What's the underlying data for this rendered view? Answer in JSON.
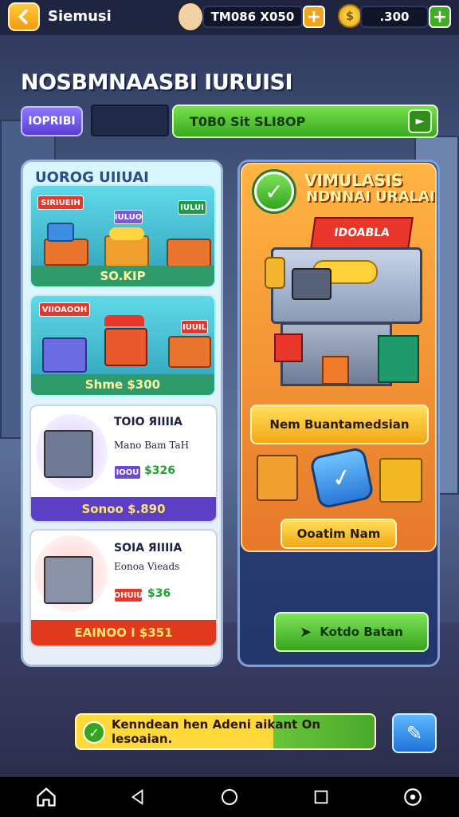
{
  "header": {
    "title": "Siemusi",
    "currency1": "TM086 X050",
    "currency2": ".300",
    "coin_symbol": "$"
  },
  "heading": "NOSBMNAASBI IURUISI",
  "controls": {
    "tab_label": "IOPRIBI",
    "green_bar_label": "T0B0 Sit SLI8OP"
  },
  "left_panel": {
    "title": "UOROG UIIUAI",
    "cards": [
      {
        "tags": [
          "SIRIUEIH",
          "IULUO",
          "IULUI"
        ],
        "bar_label": "SO.KIP"
      },
      {
        "tags": [
          "VIIOAOOH",
          "IUUIL"
        ],
        "bar_label": "Shme $300"
      },
      {
        "name": "TOIO ЯIIIIA",
        "desc": "Mano Bam TaH",
        "tag": "IOOU",
        "price": "$326",
        "bar_label": "Sonoo $.890"
      },
      {
        "name": "SOIA ЯIIIIA",
        "desc": "Eonoa Vieads",
        "tag": "OHUIU",
        "price": "$36",
        "bar_label": "EAINOO I $351"
      }
    ]
  },
  "right_panel": {
    "title": "VIMULASIS",
    "subtitle": "NDNNAI URALAI",
    "sign_text": "IDOABLA",
    "primary_button": "Nem Buantamedsian",
    "secondary_button": "Ooatim Nam",
    "green_button": "Kotdo Batan"
  },
  "footer": {
    "tip_text": "Kenndean hen Adeni aikant On lesoaian."
  },
  "colors": {
    "accent_green": "#3aa81e",
    "accent_yellow": "#f3a816",
    "accent_orange": "#e6782a",
    "panel_teal": "#2e9fb8"
  }
}
